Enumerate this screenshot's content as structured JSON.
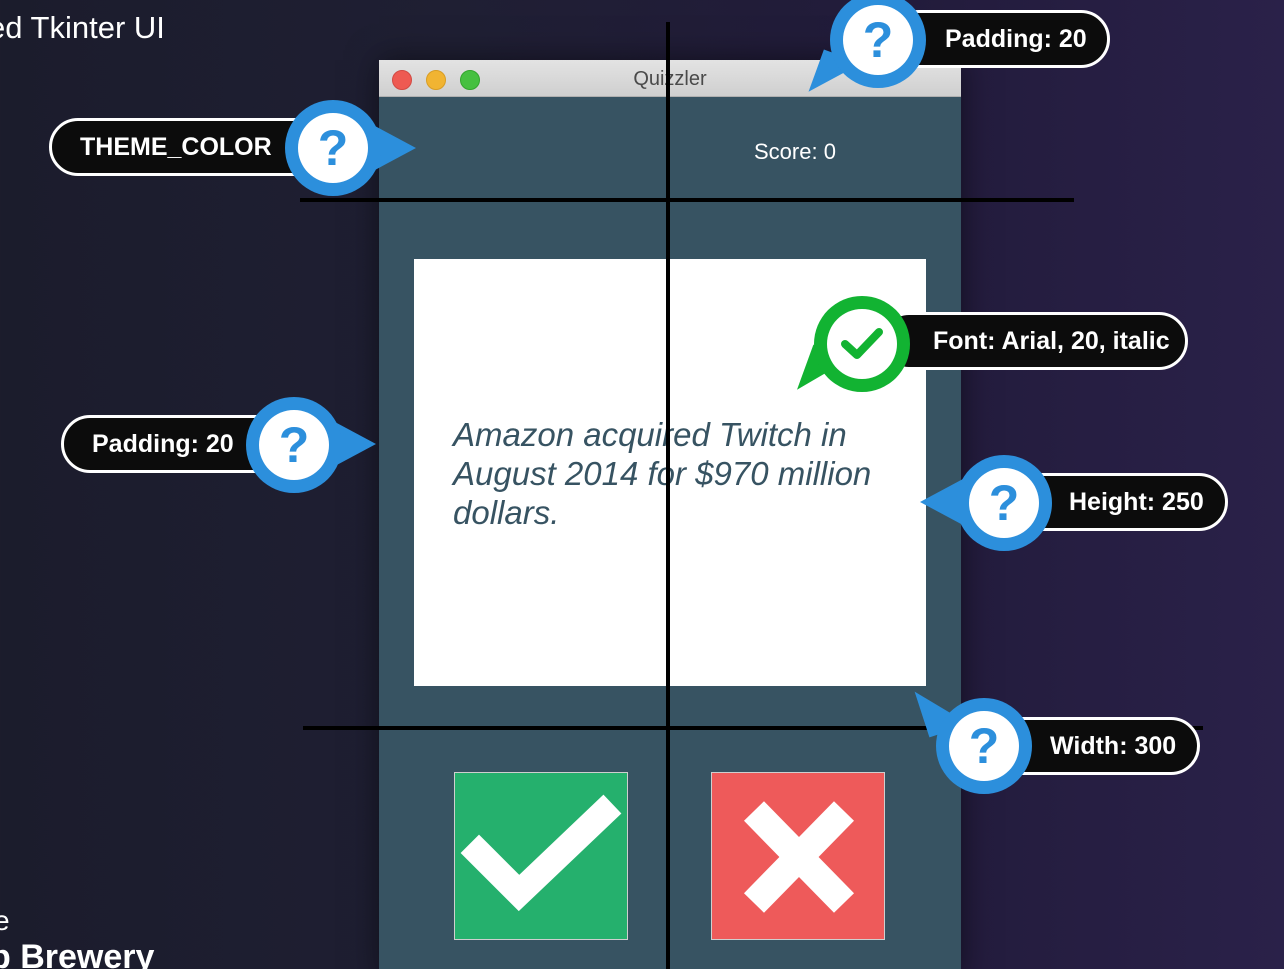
{
  "background": {
    "title_fragment": "ed Tkinter UI",
    "bottom_line_1": "e",
    "bottom_line_2": "p Brewery"
  },
  "window": {
    "title": "Quizzler",
    "score_label": "Score: 0",
    "question_text": "Amazon acquired Twitch in August 2014 for $970 million dollars.",
    "true_icon": "check-icon",
    "false_icon": "x-icon",
    "colors": {
      "theme": "#375362",
      "true": "#25b06d",
      "false": "#ee5a5a",
      "card": "#ffffff"
    }
  },
  "callouts": {
    "padding_top": "Padding: 20",
    "theme_color": "THEME_COLOR",
    "font": "Font: Arial, 20, italic",
    "padding_left": "Padding: 20",
    "height": "Height: 250",
    "width": "Width: 300",
    "question_icon_glyph": "?",
    "colors": {
      "badge_blue": "#2c8fdc",
      "badge_green": "#12b332"
    }
  }
}
